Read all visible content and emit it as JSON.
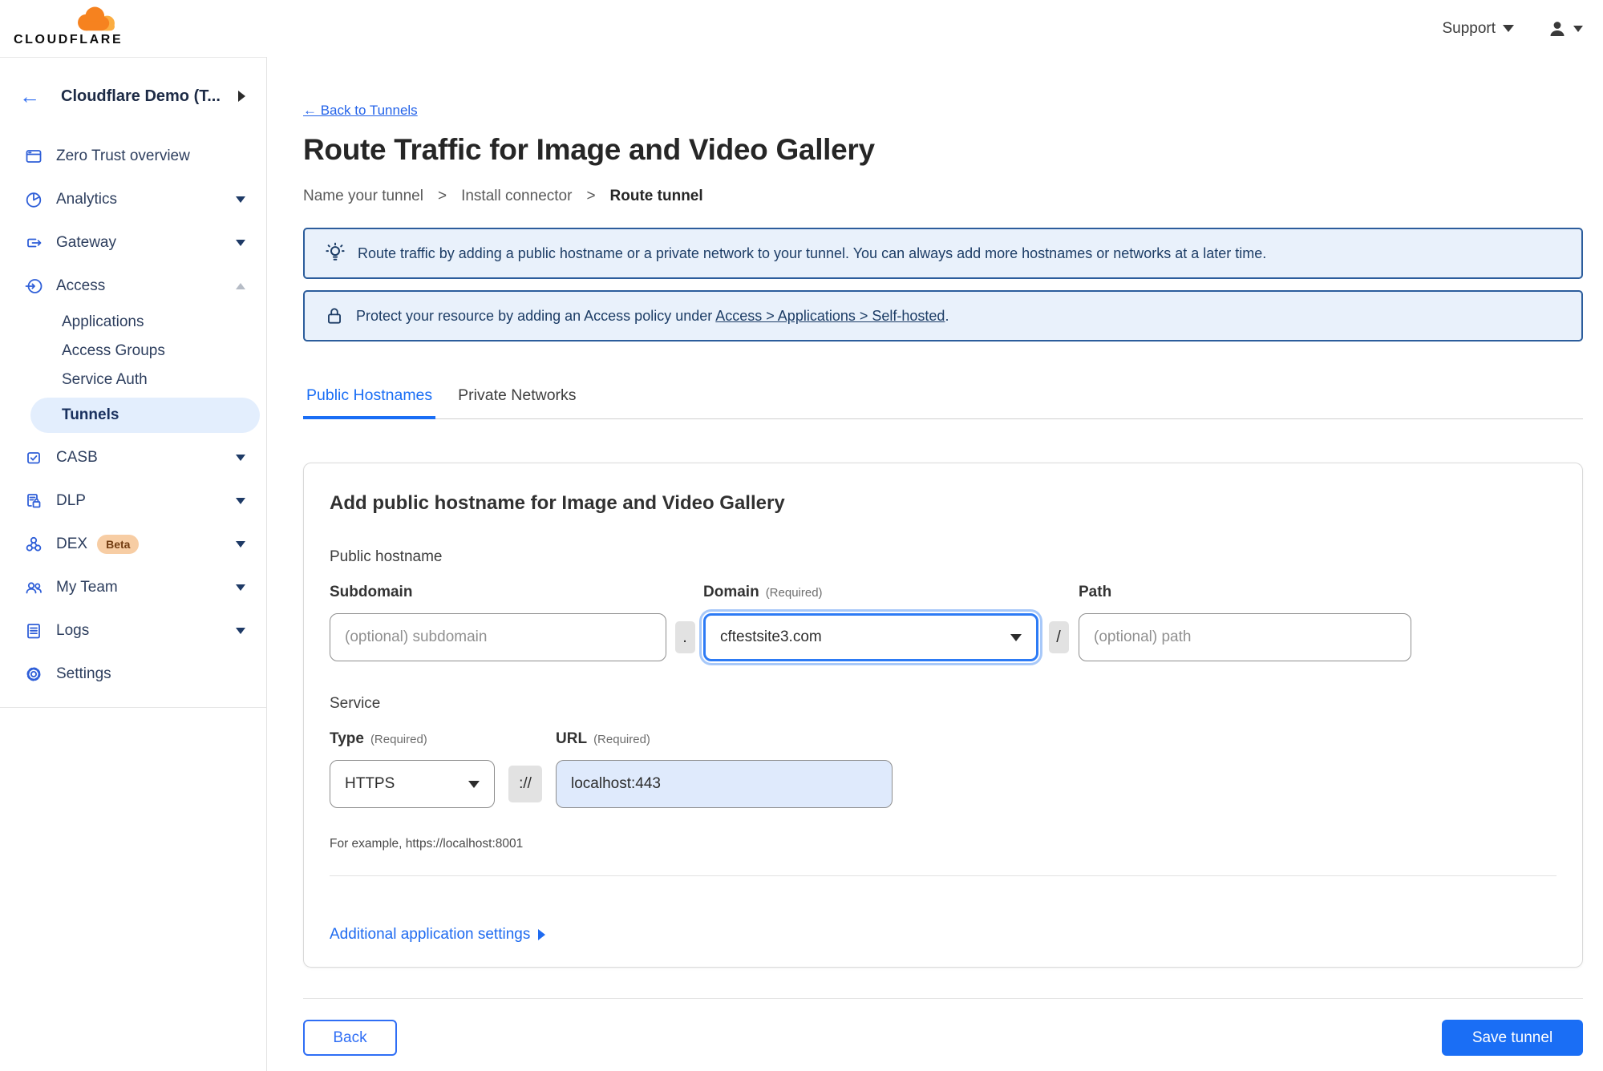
{
  "topbar": {
    "support_label": "Support"
  },
  "logo": {
    "brand": "CLOUDFLARE"
  },
  "sidebar": {
    "account_name": "Cloudflare Demo (T...",
    "items": [
      {
        "label": "Zero Trust overview",
        "icon": "browser-window-icon"
      },
      {
        "label": "Analytics",
        "icon": "pie-chart-icon",
        "chevron": "down"
      },
      {
        "label": "Gateway",
        "icon": "gateway-icon",
        "chevron": "down"
      },
      {
        "label": "Access",
        "icon": "access-icon",
        "chevron": "up",
        "expanded": true,
        "children": [
          "Applications",
          "Access Groups",
          "Service Auth",
          "Tunnels"
        ],
        "active_child": "Tunnels"
      },
      {
        "label": "CASB",
        "icon": "casb-icon",
        "chevron": "down"
      },
      {
        "label": "DLP",
        "icon": "dlp-lock-icon",
        "chevron": "down"
      },
      {
        "label": "DEX",
        "icon": "dex-network-icon",
        "chevron": "down",
        "badge": "Beta"
      },
      {
        "label": "My Team",
        "icon": "team-icon",
        "chevron": "down"
      },
      {
        "label": "Logs",
        "icon": "logs-icon",
        "chevron": "down"
      },
      {
        "label": "Settings",
        "icon": "gear-icon"
      }
    ]
  },
  "main": {
    "back_link": "← Back to Tunnels",
    "title": "Route Traffic for Image and Video Gallery",
    "step_separator": ">",
    "steps": [
      {
        "label": "Name your tunnel"
      },
      {
        "label": "Install connector"
      },
      {
        "label": "Route tunnel",
        "current": true
      }
    ],
    "banners": [
      {
        "icon": "lightbulb-icon",
        "text": "Route traffic by adding a public hostname or a private network to your tunnel. You can always add more hostnames or networks at a later time."
      },
      {
        "icon": "lock-icon",
        "text_prefix": "Protect your resource by adding an Access policy under ",
        "link": "Access > Applications > Self-hosted",
        "text_suffix": "."
      }
    ],
    "tabs": [
      {
        "label": "Public Hostnames",
        "active": true
      },
      {
        "label": "Private Networks",
        "active": false
      }
    ],
    "card": {
      "title": "Add public hostname for Image and Video Gallery",
      "public_hostname_label": "Public hostname",
      "subdomain_label": "Subdomain",
      "subdomain_placeholder": "(optional) subdomain",
      "dot_separator": ".",
      "domain_label": "Domain",
      "required_label": "(Required)",
      "domain_value": "cftestsite3.com",
      "slash_separator": "/",
      "path_label": "Path",
      "path_placeholder": "(optional) path",
      "service_label": "Service",
      "type_label": "Type",
      "type_value": "HTTPS",
      "url_label": "URL",
      "scheme_separator": "://",
      "url_value": "localhost:443",
      "example_text": "For example, https://localhost:8001",
      "additional_settings_label": "Additional application settings"
    },
    "footer": {
      "back_label": "Back",
      "save_label": "Save tunnel"
    }
  },
  "colors": {
    "accent_blue": "#1a6ef5",
    "banner_bg": "#e9f1fb",
    "banner_border": "#2c5d9c",
    "banner_text": "#1d3d66",
    "active_nav_bg": "#e3eefd",
    "beta_badge_bg": "#f7cda4",
    "url_field_bg": "#dfeafc",
    "logo_orange": "#f6821f",
    "logo_light_orange": "#fbad41"
  }
}
